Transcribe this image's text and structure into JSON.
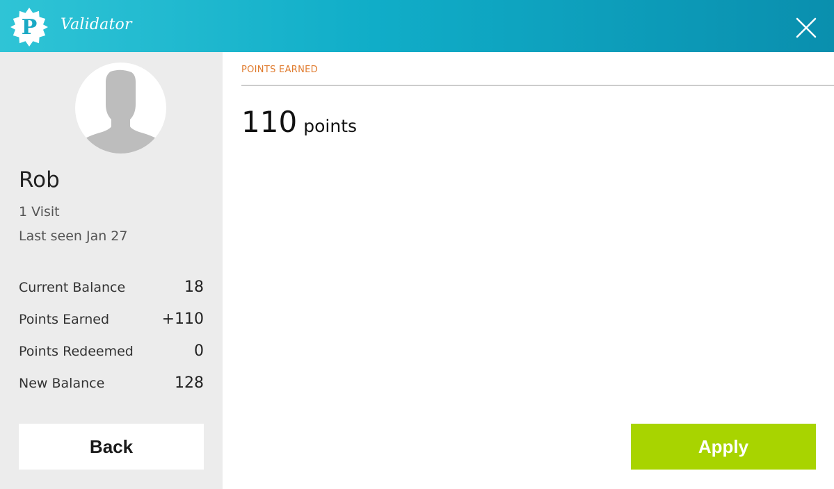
{
  "header": {
    "logo_letter": "P",
    "title": "Validator",
    "close_icon": "close-icon"
  },
  "customer": {
    "avatar_icon": "person-silhouette-icon",
    "name": "Rob",
    "visits": "1 Visit",
    "last_seen": "Last seen Jan 27"
  },
  "stats": [
    {
      "label": "Current Balance",
      "value": "18"
    },
    {
      "label": "Points Earned",
      "value": "+110"
    },
    {
      "label": "Points Redeemed",
      "value": "0"
    },
    {
      "label": "New Balance",
      "value": "128"
    }
  ],
  "main": {
    "section_label": "POINTS EARNED",
    "points_value": "110",
    "points_unit": "points"
  },
  "actions": {
    "back_label": "Back",
    "apply_label": "Apply"
  },
  "colors": {
    "header_start": "#2fc4d6",
    "header_end": "#0a8fae",
    "sidebar_bg": "#ececec",
    "section_label": "#e07b2e",
    "apply_button": "#a8d400"
  }
}
